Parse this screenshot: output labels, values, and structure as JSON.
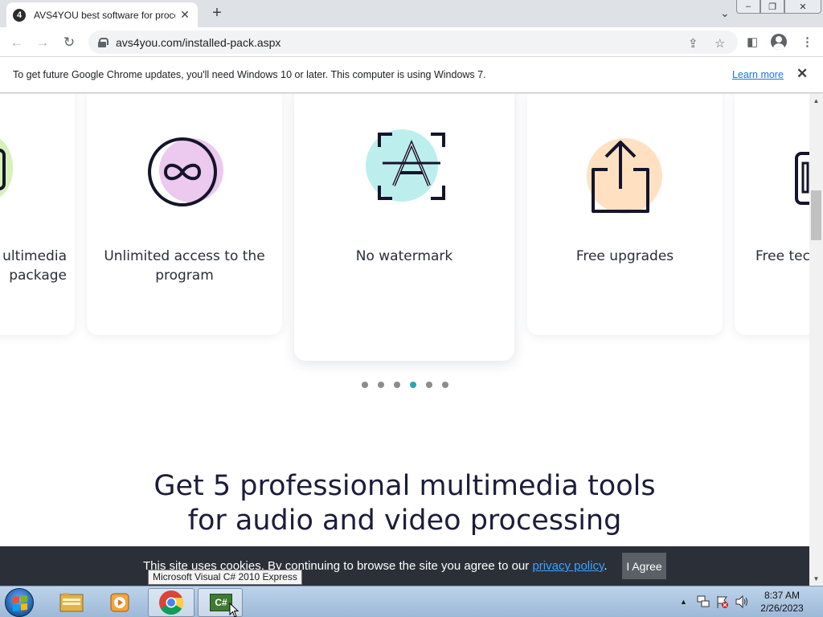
{
  "browser": {
    "tab": {
      "title": "AVS4YOU best software for proce",
      "favicon_text": "4",
      "close_glyph": "✕"
    },
    "new_tab_glyph": "+",
    "tab_list_glyph": "⌄",
    "window_buttons": [
      "–",
      "❐",
      "✕"
    ],
    "nav": {
      "back_glyph": "←",
      "forward_glyph": "→",
      "reload_glyph": "↻"
    },
    "url": "avs4you.com/installed-pack.aspx",
    "toolbar_glyphs": {
      "share": "⇪",
      "bookmark": "☆",
      "sidepanel": "◧",
      "menu": "⋮"
    }
  },
  "infobar": {
    "message": "To get future Google Chrome updates, you'll need Windows 10 or later. This computer is using Windows 7.",
    "learn_more": "Learn more",
    "close_glyph": "✕"
  },
  "features": [
    {
      "label": "ultimedia package",
      "line1": "ultimedia",
      "line2": "package",
      "icon": "screen-icon",
      "accent": "#d6f0b8"
    },
    {
      "label": "Unlimited access to the program",
      "line1": "Unlimited access to the",
      "line2": "program",
      "icon": "infinity-icon",
      "accent": "#ecc9ee"
    },
    {
      "label": "No watermark",
      "line1": "No watermark",
      "line2": "",
      "icon": "no-watermark-icon",
      "accent": "#bdeeee"
    },
    {
      "label": "Free upgrades",
      "line1": "Free upgrades",
      "line2": "",
      "icon": "upload-icon",
      "accent": "#ffe1c2"
    },
    {
      "label": "Free tec",
      "line1": "Free tec",
      "line2": "",
      "icon": "support-icon",
      "accent": "#e8e8e8"
    }
  ],
  "carousel": {
    "count": 6,
    "active_index": 3
  },
  "headline": {
    "line1": "Get 5 professional multimedia tools",
    "line2": "for audio and video processing"
  },
  "cookie_banner": {
    "text_before": "This site uses cookies. By continuing to browse the site you agree to our ",
    "link": "privacy policy",
    "text_after": ".",
    "agree_button": "I Agree"
  },
  "tooltip": "Microsoft Visual C# 2010 Express",
  "taskbar": {
    "apps": [
      "windows-explorer",
      "media-player",
      "google-chrome",
      "visual-csharp-express"
    ],
    "csharp_label": "C#",
    "tray_glyphs": "▲",
    "time": "8:37 AM",
    "date": "2/26/2023"
  },
  "colors": {
    "dot_active": "#2aa5b8",
    "link": "#1a73e8",
    "headline": "#1b1d3a",
    "cookie_bg": "#2b2f38"
  }
}
